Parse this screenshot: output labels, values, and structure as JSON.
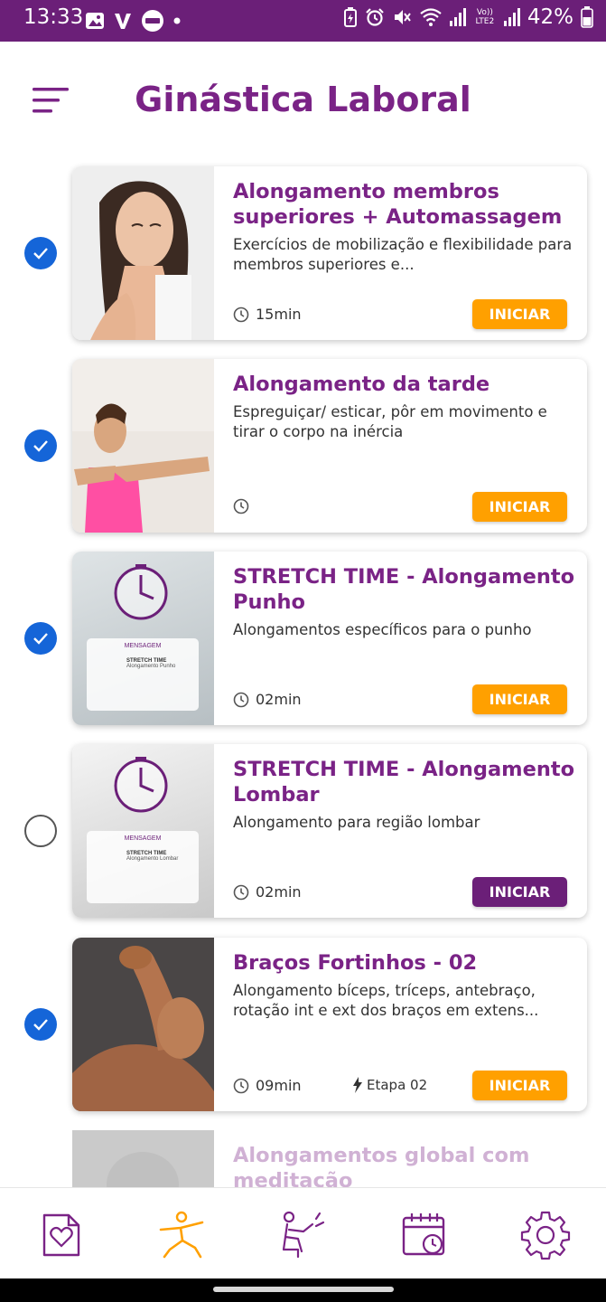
{
  "status_bar": {
    "time": "13:33",
    "battery": "42%",
    "network": "Vo)) LTE2"
  },
  "header": {
    "title": "Ginástica Laboral"
  },
  "activities": [
    {
      "title": "Alongamento membros superiores + Automassagem",
      "description": "Exercícios de mobilização e flexibilidade para membros superiores e...",
      "duration": "15min",
      "button": "INICIAR",
      "completed": true
    },
    {
      "title": "Alongamento da tarde",
      "description": "Espreguiçar/ esticar, pôr em movimento e tirar o corpo na inércia",
      "duration": "",
      "button": "INICIAR",
      "completed": true
    },
    {
      "title": "STRETCH TIME - Alongamento Punho",
      "description": "Alongamentos específicos para o punho",
      "duration": "02min",
      "button": "INICIAR",
      "completed": true,
      "thumb_label": "MENSAGEM",
      "thumb_heading": "STRETCH TIME",
      "thumb_sub": "Alongamento Punho"
    },
    {
      "title": "STRETCH TIME - Alongamento Lombar",
      "description": "Alongamento para região lombar",
      "duration": "02min",
      "button": "INICIAR",
      "completed": false,
      "thumb_label": "MENSAGEM",
      "thumb_heading": "STRETCH TIME",
      "thumb_sub": "Alongamento Lombar"
    },
    {
      "title": "Braços Fortinhos - 02",
      "description": "Alongamento bíceps, tríceps, antebraço, rotação int e ext  dos braços em extens...",
      "duration": "09min",
      "stage": "Etapa 02",
      "button": "INICIAR",
      "completed": true
    },
    {
      "title": "Alongamentos global com meditação"
    }
  ],
  "colors": {
    "brand_purple": "#7a2386",
    "start_orange": "#ffa000",
    "check_blue": "#1565d8"
  },
  "nav_icons": [
    "health-card-icon",
    "exercise-icon",
    "ergonomics-icon",
    "calendar-icon",
    "settings-icon"
  ]
}
